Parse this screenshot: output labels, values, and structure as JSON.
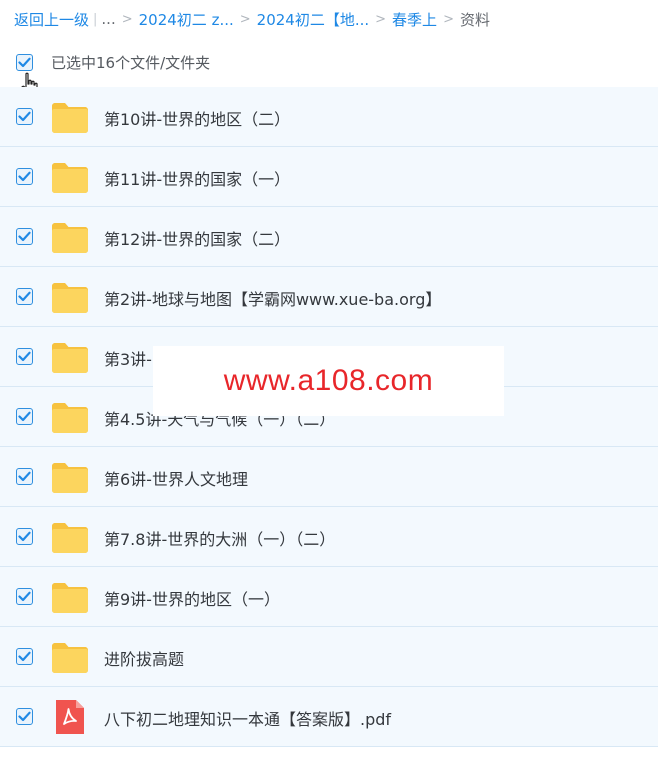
{
  "breadcrumb": {
    "back": "返回上一级",
    "ellipsis": "...",
    "crumbs": [
      "2024初二 z...",
      "2024初二【地...",
      "春季上"
    ],
    "current": "资料"
  },
  "selection": {
    "summary": "已选中16个文件/文件夹"
  },
  "files": [
    {
      "name": "第10讲-世界的地区（二）",
      "type": "folder-icon"
    },
    {
      "name": "第11讲-世界的国家（一）",
      "type": "folder-icon"
    },
    {
      "name": "第12讲-世界的国家（二）",
      "type": "folder-icon"
    },
    {
      "name": "第2讲-地球与地图【学霸网www.xue-ba.org】",
      "type": "folder-icon"
    },
    {
      "name": "第3讲-",
      "type": "folder-icon"
    },
    {
      "name": "第4.5讲-天气与气候（一）（二）",
      "type": "folder-icon"
    },
    {
      "name": "第6讲-世界人文地理",
      "type": "folder-icon"
    },
    {
      "name": "第7.8讲-世界的大洲（一）（二）",
      "type": "folder-icon"
    },
    {
      "name": "第9讲-世界的地区（一）",
      "type": "folder-icon"
    },
    {
      "name": "进阶拔高题",
      "type": "folder-icon"
    },
    {
      "name": "八下初二地理知识一本通【答案版】.pdf",
      "type": "pdf-icon"
    }
  ],
  "watermark": {
    "text": "www.a108.com"
  },
  "colors": {
    "accent": "#1e88e5",
    "row_bg": "#f3f9fe",
    "folder": "#fcd15a",
    "pdf": "#f0544f",
    "watermark": "#e8262a"
  }
}
